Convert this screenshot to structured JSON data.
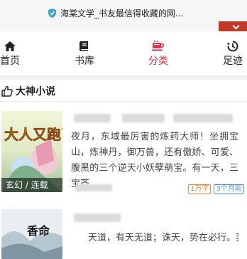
{
  "browser": {
    "url_title": "海棠文学_书友最信得收藏的网..."
  },
  "nav": {
    "items": [
      {
        "label": "首页",
        "icon": "home-icon"
      },
      {
        "label": "书库",
        "icon": "book-icon"
      },
      {
        "label": "分类",
        "icon": "cup-icon",
        "active": true
      },
      {
        "label": "足迹",
        "icon": "history-icon"
      }
    ]
  },
  "section": {
    "title": "大神小说",
    "icon": "thumbs-up-icon"
  },
  "books": [
    {
      "cover_title": "大人又跑了",
      "cover_tag": "玄幻 / 连载",
      "description": "夜月，东域最厉害的炼药大师！坐拥宝山，炼神丹，御万兽，还有傲娇、可爱、腹黑的三个逆天小妖孽萌宝。有一天，三宝齐",
      "badges": [
        "1万字",
        "3个月前"
      ]
    },
    {
      "cover_title": "香命",
      "description": "天道，有天无道；诛天，势在必行。我"
    }
  ],
  "colors": {
    "accent": "#d9344a",
    "badge_orange": "#e58b3a",
    "badge_blue": "#4a8fd6"
  }
}
